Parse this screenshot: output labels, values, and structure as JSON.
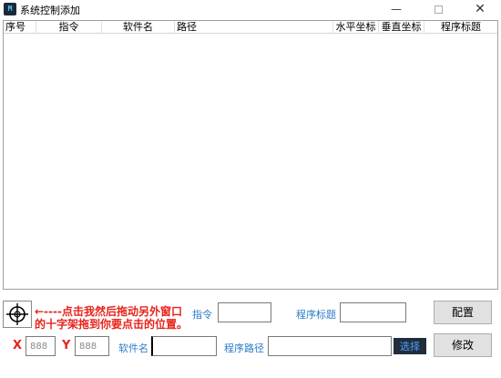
{
  "window": {
    "title": "系统控制添加",
    "app_icon_text": "M",
    "min_glyph": "—",
    "close_glyph": "✕"
  },
  "list": {
    "columns": [
      "序号",
      "指令",
      "软件名",
      "路径",
      "水平坐标",
      "垂直坐标",
      "程序标题"
    ]
  },
  "panel": {
    "instruction_line1": "←----点击我然后拖动另外窗口",
    "instruction_line2": "的十字架拖到你要点击的位置。",
    "command_label": "指令",
    "command_value": "",
    "title_label": "程序标题",
    "title_value": "",
    "x_label": "X",
    "x_value": "888",
    "y_label": "Y",
    "y_value": "888",
    "software_label": "软件名",
    "software_value": "",
    "path_label": "程序路径",
    "path_value": "",
    "select_button": "选择",
    "config_button": "配置",
    "modify_button": "修改"
  },
  "colors": {
    "accent_blue": "#2b7cc9",
    "warning_red": "#e8221b",
    "select_bg": "#1f2d3d"
  },
  "icons": {
    "crosshair": "crosshair-icon",
    "app": "app-icon"
  }
}
